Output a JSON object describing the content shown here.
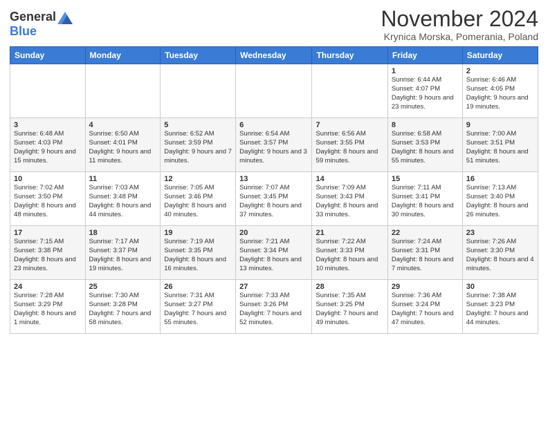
{
  "header": {
    "logo": {
      "general": "General",
      "blue": "Blue"
    },
    "title": "November 2024",
    "location": "Krynica Morska, Pomerania, Poland"
  },
  "days_of_week": [
    "Sunday",
    "Monday",
    "Tuesday",
    "Wednesday",
    "Thursday",
    "Friday",
    "Saturday"
  ],
  "weeks": [
    [
      {
        "day": "",
        "info": ""
      },
      {
        "day": "",
        "info": ""
      },
      {
        "day": "",
        "info": ""
      },
      {
        "day": "",
        "info": ""
      },
      {
        "day": "",
        "info": ""
      },
      {
        "day": "1",
        "info": "Sunrise: 6:44 AM\nSunset: 4:07 PM\nDaylight: 9 hours and 23 minutes."
      },
      {
        "day": "2",
        "info": "Sunrise: 6:46 AM\nSunset: 4:05 PM\nDaylight: 9 hours and 19 minutes."
      }
    ],
    [
      {
        "day": "3",
        "info": "Sunrise: 6:48 AM\nSunset: 4:03 PM\nDaylight: 9 hours and 15 minutes."
      },
      {
        "day": "4",
        "info": "Sunrise: 6:50 AM\nSunset: 4:01 PM\nDaylight: 9 hours and 11 minutes."
      },
      {
        "day": "5",
        "info": "Sunrise: 6:52 AM\nSunset: 3:59 PM\nDaylight: 9 hours and 7 minutes."
      },
      {
        "day": "6",
        "info": "Sunrise: 6:54 AM\nSunset: 3:57 PM\nDaylight: 9 hours and 3 minutes."
      },
      {
        "day": "7",
        "info": "Sunrise: 6:56 AM\nSunset: 3:55 PM\nDaylight: 8 hours and 59 minutes."
      },
      {
        "day": "8",
        "info": "Sunrise: 6:58 AM\nSunset: 3:53 PM\nDaylight: 8 hours and 55 minutes."
      },
      {
        "day": "9",
        "info": "Sunrise: 7:00 AM\nSunset: 3:51 PM\nDaylight: 8 hours and 51 minutes."
      }
    ],
    [
      {
        "day": "10",
        "info": "Sunrise: 7:02 AM\nSunset: 3:50 PM\nDaylight: 8 hours and 48 minutes."
      },
      {
        "day": "11",
        "info": "Sunrise: 7:03 AM\nSunset: 3:48 PM\nDaylight: 8 hours and 44 minutes."
      },
      {
        "day": "12",
        "info": "Sunrise: 7:05 AM\nSunset: 3:46 PM\nDaylight: 8 hours and 40 minutes."
      },
      {
        "day": "13",
        "info": "Sunrise: 7:07 AM\nSunset: 3:45 PM\nDaylight: 8 hours and 37 minutes."
      },
      {
        "day": "14",
        "info": "Sunrise: 7:09 AM\nSunset: 3:43 PM\nDaylight: 8 hours and 33 minutes."
      },
      {
        "day": "15",
        "info": "Sunrise: 7:11 AM\nSunset: 3:41 PM\nDaylight: 8 hours and 30 minutes."
      },
      {
        "day": "16",
        "info": "Sunrise: 7:13 AM\nSunset: 3:40 PM\nDaylight: 8 hours and 26 minutes."
      }
    ],
    [
      {
        "day": "17",
        "info": "Sunrise: 7:15 AM\nSunset: 3:38 PM\nDaylight: 8 hours and 23 minutes."
      },
      {
        "day": "18",
        "info": "Sunrise: 7:17 AM\nSunset: 3:37 PM\nDaylight: 8 hours and 19 minutes."
      },
      {
        "day": "19",
        "info": "Sunrise: 7:19 AM\nSunset: 3:35 PM\nDaylight: 8 hours and 16 minutes."
      },
      {
        "day": "20",
        "info": "Sunrise: 7:21 AM\nSunset: 3:34 PM\nDaylight: 8 hours and 13 minutes."
      },
      {
        "day": "21",
        "info": "Sunrise: 7:22 AM\nSunset: 3:33 PM\nDaylight: 8 hours and 10 minutes."
      },
      {
        "day": "22",
        "info": "Sunrise: 7:24 AM\nSunset: 3:31 PM\nDaylight: 8 hours and 7 minutes."
      },
      {
        "day": "23",
        "info": "Sunrise: 7:26 AM\nSunset: 3:30 PM\nDaylight: 8 hours and 4 minutes."
      }
    ],
    [
      {
        "day": "24",
        "info": "Sunrise: 7:28 AM\nSunset: 3:29 PM\nDaylight: 8 hours and 1 minute."
      },
      {
        "day": "25",
        "info": "Sunrise: 7:30 AM\nSunset: 3:28 PM\nDaylight: 7 hours and 58 minutes."
      },
      {
        "day": "26",
        "info": "Sunrise: 7:31 AM\nSunset: 3:27 PM\nDaylight: 7 hours and 55 minutes."
      },
      {
        "day": "27",
        "info": "Sunrise: 7:33 AM\nSunset: 3:26 PM\nDaylight: 7 hours and 52 minutes."
      },
      {
        "day": "28",
        "info": "Sunrise: 7:35 AM\nSunset: 3:25 PM\nDaylight: 7 hours and 49 minutes."
      },
      {
        "day": "29",
        "info": "Sunrise: 7:36 AM\nSunset: 3:24 PM\nDaylight: 7 hours and 47 minutes."
      },
      {
        "day": "30",
        "info": "Sunrise: 7:38 AM\nSunset: 3:23 PM\nDaylight: 7 hours and 44 minutes."
      }
    ]
  ]
}
